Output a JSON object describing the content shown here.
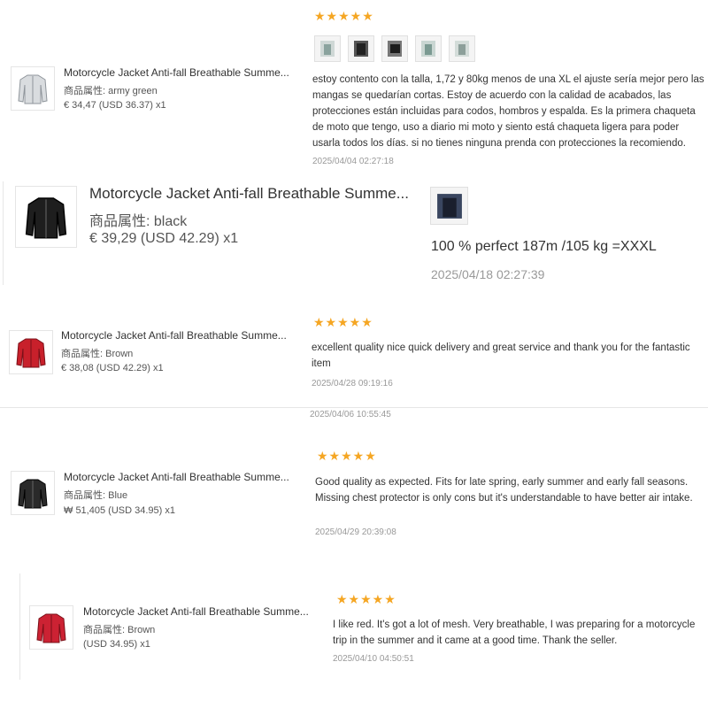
{
  "reviews": [
    {
      "product_title": "Motorcycle Jacket Anti-fall Breathable Summe...",
      "attr_label": "商品属性:",
      "attr_value": "army green",
      "price": "€ 34,47",
      "usd": "(USD  36.37)",
      "qty": "x1",
      "rating": 5,
      "stars": "★★★★★",
      "photo_count": 5,
      "text": "estoy contento con la talla, 1,72 y 80kg menos de una XL el ajuste sería mejor pero las mangas se quedarían cortas. Estoy de acuerdo con la calidad de acabados, las protecciones están incluidas para codos, hombros y espalda. Es la primera chaqueta de moto que tengo, uso a diario mi moto y siento está chaqueta ligera para poder usarla todos los días. si no tienes ninguna prenda con protecciones la recomiendo.",
      "date": "2025/04/04 02:27:18",
      "jacket_color": "#d9dcdf"
    },
    {
      "product_title": "Motorcycle Jacket Anti-fall Breathable Summe...",
      "attr_label": "商品属性:",
      "attr_value": "black",
      "price": "€ 39,29",
      "usd": "(USD  42.29)",
      "qty": "x1",
      "photo_count": 1,
      "text": "100 % perfect 187m /105 kg =XXXL",
      "date": "2025/04/18 02:27:39",
      "jacket_color": "#1e1e1e"
    },
    {
      "product_title": "Motorcycle Jacket Anti-fall Breathable Summe...",
      "attr_label": "商品属性:",
      "attr_value": "Brown",
      "price": "€ 38,08",
      "usd": "(USD  42.29)",
      "qty": "x1",
      "rating": 5,
      "stars": "★★★★★",
      "text": "excellent quality nice quick delivery and great service and thank you for the fantastic item",
      "date": "2025/04/28 09:19:16",
      "jacket_color": "#c8202b"
    },
    {
      "product_title": "Motorcycle Jacket Anti-fall Breathable Summe...",
      "attr_label": "商品属性:",
      "attr_value": "Blue",
      "price": "₩ 51,405",
      "usd": "(USD  34.95)",
      "qty": "x1",
      "rating": 5,
      "stars": "★★★★★",
      "text": "Good quality as expected. Fits for late spring, early summer and early fall seasons. Missing chest protector is only cons but it's understandable to have better air intake.",
      "date": "2025/04/29 20:39:08",
      "jacket_color": "#2a2a2a"
    },
    {
      "product_title": "Motorcycle Jacket Anti-fall Breathable Summe...",
      "attr_label": "商品属性:",
      "attr_value": "Brown",
      "price": "",
      "usd": "(USD  34.95)",
      "qty": "x1",
      "rating": 5,
      "stars": "★★★★★",
      "text": "I like red. It's got a lot of mesh. Very breathable, I was preparing for a motorcycle trip in the summer and it came at a good time. Thank the seller.",
      "date": "2025/04/10 04:50:51",
      "jacket_color": "#cc2233"
    }
  ],
  "stray_date": "2025/04/06 10:55:45",
  "colors": {
    "star": "#f5a623",
    "date": "#999999",
    "divider": "#e6e6e6"
  }
}
